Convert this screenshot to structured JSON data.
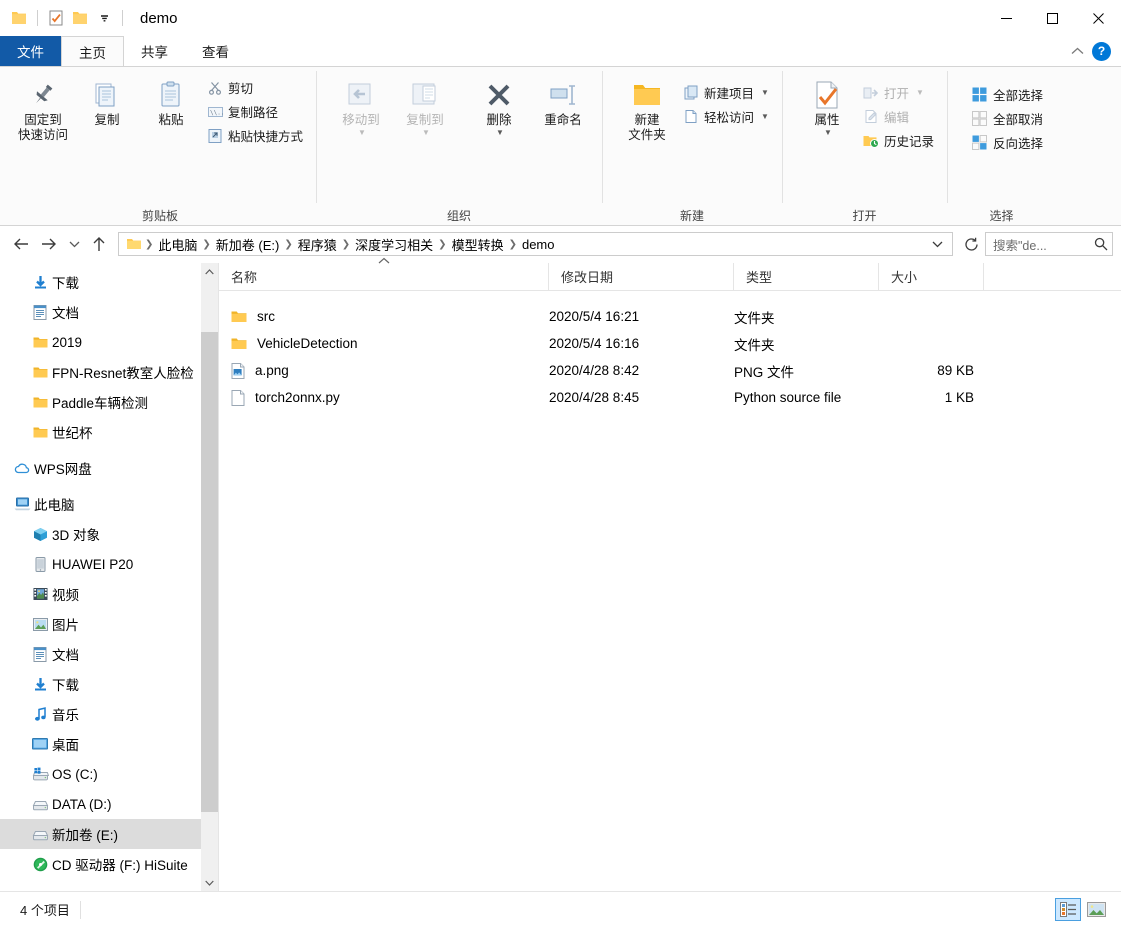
{
  "window": {
    "title": "demo",
    "quick_access_toolbar": [
      {
        "name": "folder-icon",
        "label": "属性"
      },
      {
        "name": "properties-icon",
        "label": "属性"
      },
      {
        "name": "new-folder-icon",
        "label": "新建文件夹"
      },
      {
        "name": "chevron-down-icon",
        "label": "自定义快速访问工具栏"
      }
    ],
    "controls": {
      "minimize": "—",
      "maximize": "▢",
      "close": "✕"
    }
  },
  "ribbon": {
    "tabs": [
      {
        "label": "文件",
        "state": "file"
      },
      {
        "label": "主页",
        "state": "active"
      },
      {
        "label": "共享",
        "state": "normal"
      },
      {
        "label": "查看",
        "state": "normal"
      }
    ],
    "collapse_icon": "⌃",
    "help_label": "?",
    "groups": [
      {
        "label": "剪贴板",
        "big": [
          {
            "label": "固定到\n快速访问",
            "line1": "固定到",
            "line2": "快速访问",
            "icon": "pin-icon"
          },
          {
            "label": "复制",
            "icon": "copy-icon"
          },
          {
            "label": "粘贴",
            "icon": "paste-icon"
          }
        ],
        "small": [
          {
            "label": "剪切",
            "icon": "cut-icon"
          },
          {
            "label": "复制路径",
            "icon": "copy-path-icon"
          },
          {
            "label": "粘贴快捷方式",
            "icon": "paste-shortcut-icon"
          }
        ]
      },
      {
        "label": "组织",
        "big": [
          {
            "label": "移动到",
            "icon": "move-to-icon",
            "caret": true,
            "disabled": true
          },
          {
            "label": "复制到",
            "icon": "copy-to-icon",
            "caret": true,
            "disabled": true
          },
          {
            "label": "删除",
            "icon": "delete-icon",
            "caret": true
          },
          {
            "label": "重命名",
            "icon": "rename-icon"
          }
        ]
      },
      {
        "label": "新建",
        "big": [
          {
            "line1": "新建",
            "line2": "文件夹",
            "label": "新建文件夹",
            "icon": "new-folder-big-icon"
          }
        ],
        "small": [
          {
            "label": "新建项目",
            "icon": "new-item-icon",
            "caret": true
          },
          {
            "label": "轻松访问",
            "icon": "easy-access-icon",
            "caret": true
          }
        ]
      },
      {
        "label": "打开",
        "big": [
          {
            "label": "属性",
            "icon": "properties-big-icon",
            "caret": true
          }
        ],
        "small": [
          {
            "label": "打开",
            "icon": "open-icon",
            "caret": true,
            "disabled": true
          },
          {
            "label": "编辑",
            "icon": "edit-icon",
            "disabled": true
          },
          {
            "label": "历史记录",
            "icon": "history-icon"
          }
        ]
      },
      {
        "label": "选择",
        "small": [
          {
            "label": "全部选择",
            "icon": "select-all-icon"
          },
          {
            "label": "全部取消",
            "icon": "select-none-icon"
          },
          {
            "label": "反向选择",
            "icon": "invert-selection-icon"
          }
        ]
      }
    ]
  },
  "addressbar": {
    "back_icon": "←",
    "forward_icon": "→",
    "recent_icon": "⌄",
    "up_icon": "↑",
    "breadcrumbs": [
      "此电脑",
      "新加卷 (E:)",
      "程序猿",
      "深度学习相关",
      "模型转换",
      "demo"
    ],
    "dropdown_icon": "⌄",
    "refresh_icon": "↻",
    "search_text": "搜索\"de...",
    "search_icon": "search-icon"
  },
  "sidebar": {
    "items": [
      {
        "label": "下载",
        "icon": "download-icon",
        "indent": 2,
        "pinned": true
      },
      {
        "label": "文档",
        "icon": "documents-icon",
        "indent": 2,
        "pinned": true
      },
      {
        "label": "2019",
        "icon": "folder-icon",
        "indent": 2
      },
      {
        "label": "FPN-Resnet教室人脸检",
        "icon": "folder-icon",
        "indent": 2
      },
      {
        "label": "Paddle车辆检测",
        "icon": "folder-icon",
        "indent": 2
      },
      {
        "label": "世纪杯",
        "icon": "folder-icon",
        "indent": 2
      },
      {
        "gap": true
      },
      {
        "label": "WPS网盘",
        "icon": "cloud-icon",
        "indent": 1
      },
      {
        "gap": true
      },
      {
        "label": "此电脑",
        "icon": "this-pc-icon",
        "indent": 1
      },
      {
        "label": "3D 对象",
        "icon": "3d-objects-icon",
        "indent": 2
      },
      {
        "label": "HUAWEI P20",
        "icon": "phone-icon",
        "indent": 2
      },
      {
        "label": "视频",
        "icon": "videos-icon",
        "indent": 2
      },
      {
        "label": "图片",
        "icon": "pictures-icon",
        "indent": 2
      },
      {
        "label": "文档",
        "icon": "documents-icon",
        "indent": 2
      },
      {
        "label": "下载",
        "icon": "download-icon",
        "indent": 2
      },
      {
        "label": "音乐",
        "icon": "music-icon",
        "indent": 2
      },
      {
        "label": "桌面",
        "icon": "desktop-icon",
        "indent": 2
      },
      {
        "label": "OS (C:)",
        "icon": "windows-drive-icon",
        "indent": 2
      },
      {
        "label": "DATA (D:)",
        "icon": "drive-icon",
        "indent": 2
      },
      {
        "label": "新加卷 (E:)",
        "icon": "drive-icon",
        "indent": 2,
        "selected": true
      },
      {
        "label": "CD 驱动器 (F:) HiSuite",
        "icon": "cd-drive-icon",
        "indent": 2
      },
      {
        "gap": true
      },
      {
        "label": "CD 驱动器 (F:) HiSuite",
        "icon": "cd-drive-icon",
        "indent": 1
      }
    ],
    "scroll_up_icon": "⌃",
    "scroll_down_icon": "⌄"
  },
  "filelist": {
    "columns": [
      {
        "label": "名称",
        "key": "name",
        "sorted": "asc"
      },
      {
        "label": "修改日期",
        "key": "date"
      },
      {
        "label": "类型",
        "key": "type"
      },
      {
        "label": "大小",
        "key": "size"
      }
    ],
    "sort_indicator": "⌃",
    "rows": [
      {
        "name": "src",
        "date": "2020/5/4 16:21",
        "type": "文件夹",
        "size": "",
        "icon": "folder-icon"
      },
      {
        "name": "VehicleDetection",
        "date": "2020/5/4 16:16",
        "type": "文件夹",
        "size": "",
        "icon": "folder-icon"
      },
      {
        "name": "a.png",
        "date": "2020/4/28 8:42",
        "type": "PNG 文件",
        "size": "89 KB",
        "icon": "png-file-icon"
      },
      {
        "name": "torch2onnx.py",
        "date": "2020/4/28 8:45",
        "type": "Python source file",
        "size": "1 KB",
        "icon": "python-file-icon"
      }
    ]
  },
  "statusbar": {
    "count_text": "4 个项目",
    "views": [
      {
        "name": "details-view-button",
        "label": "详细信息",
        "active": true
      },
      {
        "name": "large-icons-view-button",
        "label": "大图标",
        "active": false
      }
    ]
  },
  "colors": {
    "accent": "#0078d7",
    "file_tab": "#125aa7",
    "folder_yellow": "#ffca52",
    "selection": "#dcdcdc",
    "hover": "#e5f3ff"
  }
}
